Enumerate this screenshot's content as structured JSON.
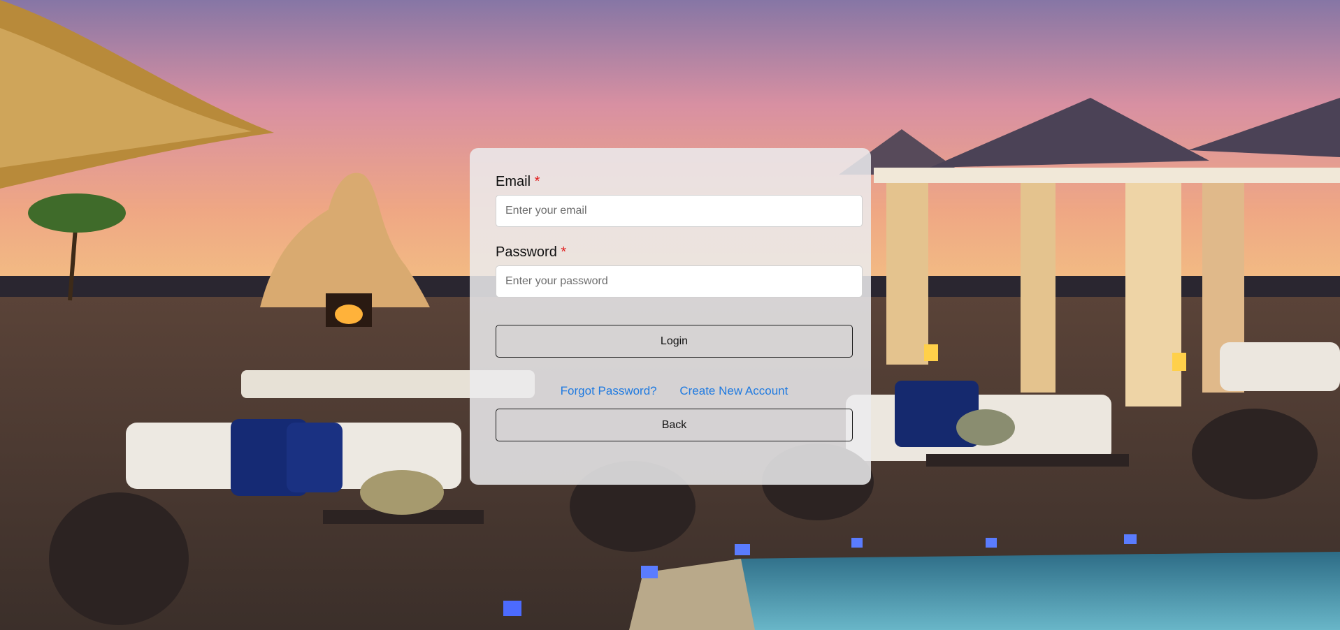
{
  "form": {
    "email_label": "Email",
    "email_required_mark": "*",
    "email_placeholder": "Enter your email",
    "email_value": "",
    "password_label": "Password",
    "password_required_mark": "*",
    "password_placeholder": "Enter your password",
    "password_value": "",
    "login_label": "Login",
    "forgot_password_label": "Forgot Password?",
    "create_account_label": "Create New Account",
    "back_label": "Back"
  },
  "colors": {
    "link": "#1f7ae0",
    "required": "#e01e1e",
    "card_background": "rgba(235,235,238,0.86)"
  }
}
